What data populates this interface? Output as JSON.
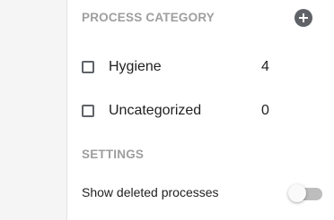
{
  "process_category": {
    "header": "PROCESS CATEGORY",
    "add_icon": "plus-circle-icon",
    "items": [
      {
        "label": "Hygiene",
        "count": "4",
        "checked": false
      },
      {
        "label": "Uncategorized",
        "count": "0",
        "checked": false
      }
    ]
  },
  "settings": {
    "header": "SETTINGS",
    "show_deleted_label": "Show deleted processes",
    "show_deleted_enabled": false
  },
  "colors": {
    "header_text": "#9e9e9e",
    "icon": "#5f6368",
    "toggle_track_off": "#bdbdbd"
  }
}
